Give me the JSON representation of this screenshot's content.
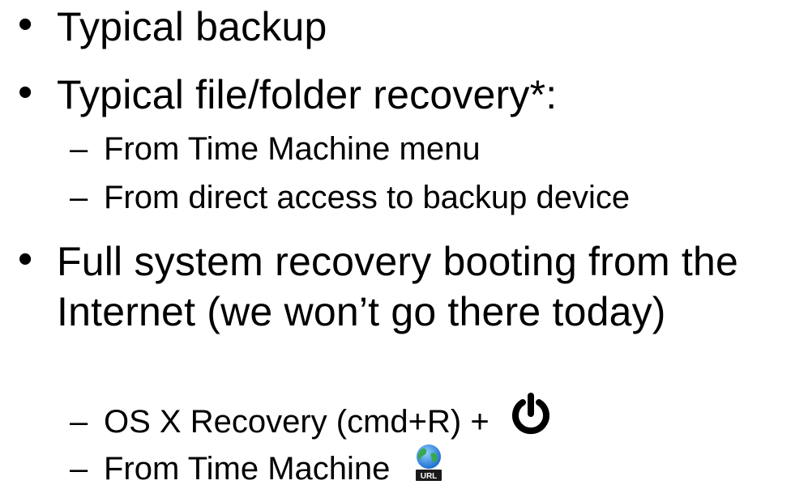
{
  "bullets": [
    {
      "text": "Typical backup",
      "subitems": []
    },
    {
      "text": "Typical file/folder recovery*:",
      "subitems": [
        {
          "text": "From Time Machine menu"
        },
        {
          "text": "From direct access to backup device"
        }
      ]
    },
    {
      "text": "Full system recovery booting from the Internet (we won’t go there today)",
      "subitems": [
        {
          "text": "OS X Recovery (cmd+R) +",
          "icon": "power-icon"
        },
        {
          "text": "From Time Machine",
          "icon": "url-globe-icon",
          "icon_label": "URL"
        }
      ]
    }
  ],
  "bullet_glyph": "•",
  "dash_glyph": "–",
  "colors": {
    "text": "#000000",
    "background": "#ffffff",
    "url_badge": "#1a1a1a",
    "globe_blue": "#1e6fd0",
    "globe_green": "#3aa84a"
  }
}
